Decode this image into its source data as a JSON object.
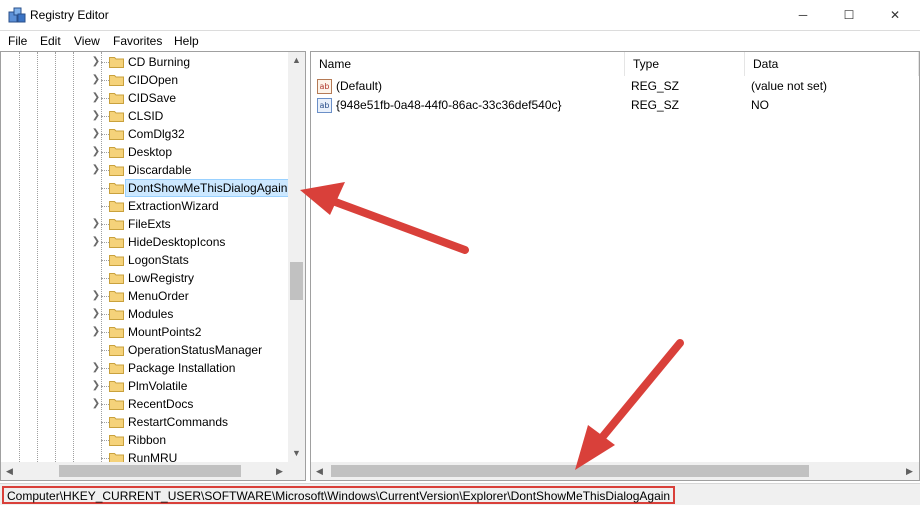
{
  "window": {
    "title": "Registry Editor",
    "controls": {
      "minimize": "─",
      "maximize": "☐",
      "close": "✕"
    }
  },
  "menu": [
    "File",
    "Edit",
    "View",
    "Favorites",
    "Help"
  ],
  "tree": {
    "items": [
      {
        "label": "CD Burning",
        "expandable": true
      },
      {
        "label": "CIDOpen",
        "expandable": true
      },
      {
        "label": "CIDSave",
        "expandable": true
      },
      {
        "label": "CLSID",
        "expandable": true
      },
      {
        "label": "ComDlg32",
        "expandable": true
      },
      {
        "label": "Desktop",
        "expandable": true
      },
      {
        "label": "Discardable",
        "expandable": true
      },
      {
        "label": "DontShowMeThisDialogAgain",
        "expandable": false,
        "selected": true
      },
      {
        "label": "ExtractionWizard",
        "expandable": false
      },
      {
        "label": "FileExts",
        "expandable": true
      },
      {
        "label": "HideDesktopIcons",
        "expandable": true
      },
      {
        "label": "LogonStats",
        "expandable": false
      },
      {
        "label": "LowRegistry",
        "expandable": false
      },
      {
        "label": "MenuOrder",
        "expandable": true
      },
      {
        "label": "Modules",
        "expandable": true
      },
      {
        "label": "MountPoints2",
        "expandable": true
      },
      {
        "label": "OperationStatusManager",
        "expandable": false
      },
      {
        "label": "Package Installation",
        "expandable": true
      },
      {
        "label": "PlmVolatile",
        "expandable": true
      },
      {
        "label": "RecentDocs",
        "expandable": true
      },
      {
        "label": "RestartCommands",
        "expandable": false
      },
      {
        "label": "Ribbon",
        "expandable": false
      },
      {
        "label": "RunMRU",
        "expandable": false
      }
    ]
  },
  "list": {
    "columns": [
      "Name",
      "Type",
      "Data"
    ],
    "rows": [
      {
        "icon": "ab",
        "name": "(Default)",
        "type": "REG_SZ",
        "data": "(value not set)"
      },
      {
        "icon": "ab",
        "name": "{948e51fb-0a48-44f0-86ac-33c36def540c}",
        "type": "REG_SZ",
        "data": "NO"
      }
    ]
  },
  "status": {
    "path": "Computer\\HKEY_CURRENT_USER\\SOFTWARE\\Microsoft\\Windows\\CurrentVersion\\Explorer\\DontShowMeThisDialogAgain"
  },
  "scroll_glyphs": {
    "up": "▲",
    "down": "▼",
    "left": "◀",
    "right": "▶"
  },
  "colors": {
    "selection": "#cce8ff",
    "annotation": "#d9403a",
    "folder": "#f5d27a"
  }
}
